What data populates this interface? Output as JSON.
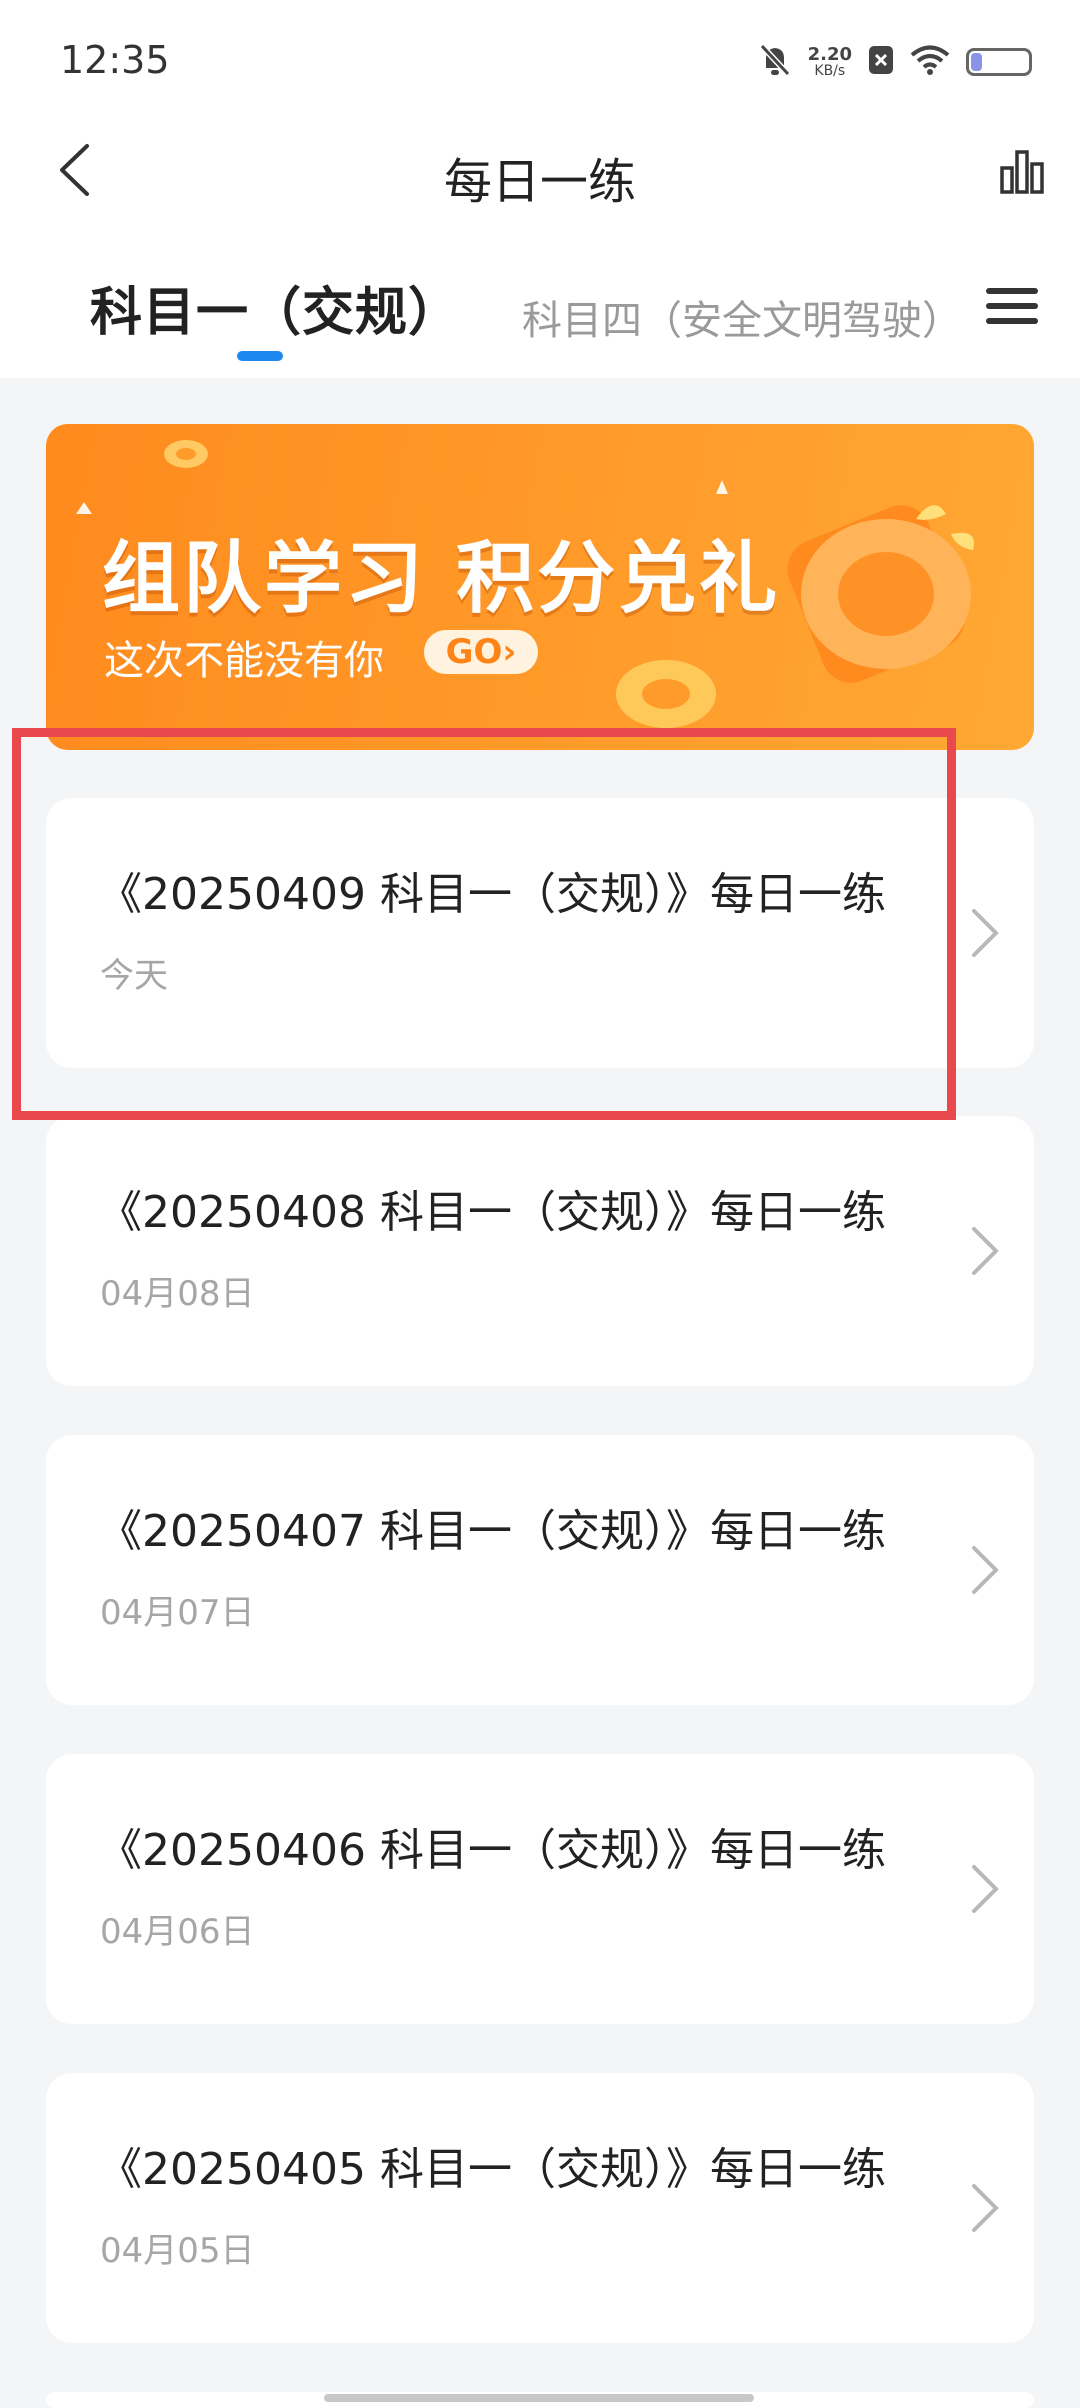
{
  "status_bar": {
    "time": "12:35",
    "net_speed_value": "2.20",
    "net_speed_unit": "KB/s",
    "icons": [
      "mute-bell-icon",
      "close-box-icon",
      "wifi-icon",
      "battery-icon"
    ],
    "battery_level": 0.2
  },
  "nav": {
    "title": "每日一练",
    "back_icon": "chevron-left-icon",
    "stats_icon": "bar-chart-icon"
  },
  "tabs": {
    "active_label": "科目一（交规）",
    "inactive_label": "科目四（安全文明驾驶）",
    "menu_icon": "hamburger-menu-icon"
  },
  "banner": {
    "title": "组队学习 积分兑礼",
    "subtitle": "这次不能没有你",
    "go_label": "GO"
  },
  "items": [
    {
      "title": "《20250409 科目一（交规）》每日一练",
      "date": "今天"
    },
    {
      "title": "《20250408 科目一（交规）》每日一练",
      "date": "04月08日"
    },
    {
      "title": "《20250407 科目一（交规）》每日一练",
      "date": "04月07日"
    },
    {
      "title": "《20250406 科目一（交规）》每日一练",
      "date": "04月06日"
    },
    {
      "title": "《20250405 科目一（交规）》每日一练",
      "date": "04月05日"
    }
  ],
  "colors": {
    "accent": "#1e88f0",
    "banner_orange": "#ff9b2a",
    "highlight": "#e8494c",
    "background": "#f4f5f7"
  }
}
